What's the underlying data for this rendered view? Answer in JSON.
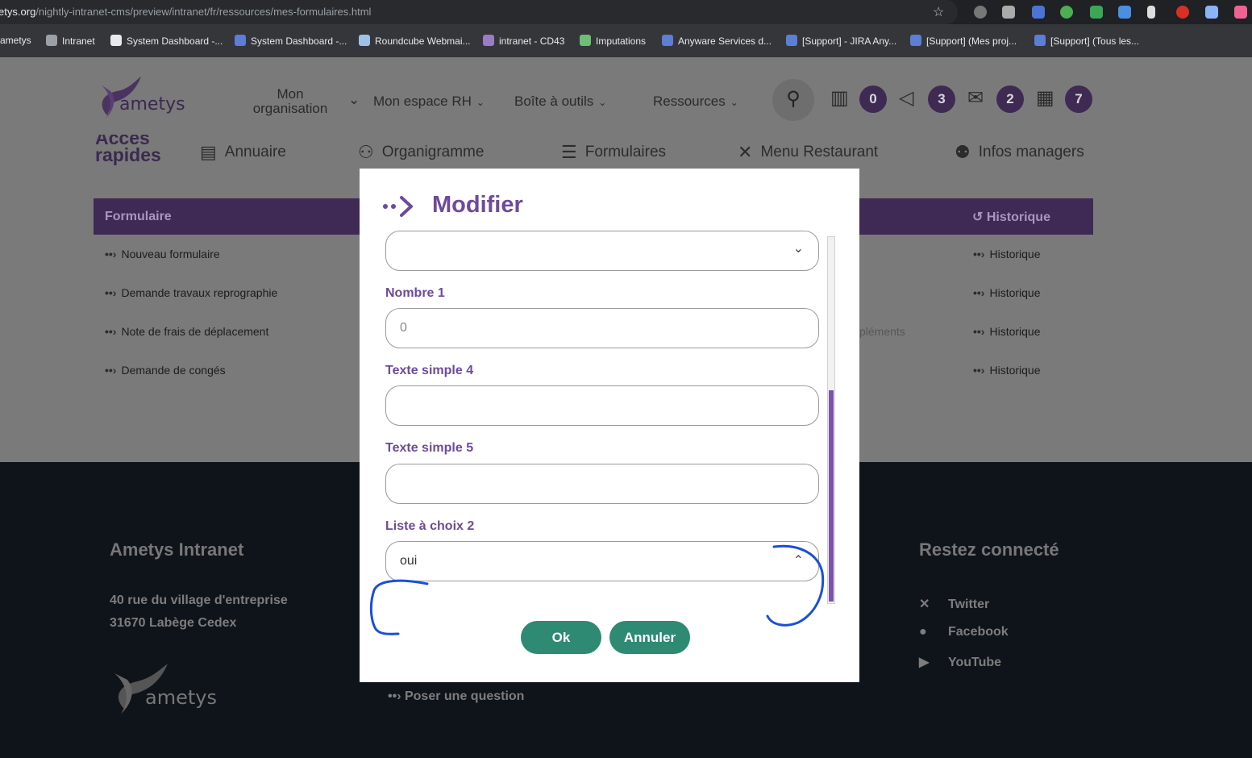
{
  "browser": {
    "url_domain": "ametys.org",
    "url_path": "/nightly-intranet-cms/preview/intranet/fr/ressources/mes-formulaires.html",
    "bookmarks": [
      "ametys",
      "Intranet",
      "System Dashboard -...",
      "System Dashboard -...",
      "Roundcube Webmai...",
      "intranet - CD43",
      "Imputations",
      "Anyware Services d...",
      "[Support] - JIRA Any...",
      "[Support] (Mes proj...",
      "[Support] (Tous les..."
    ]
  },
  "header": {
    "logo_text": "ametys",
    "nav": {
      "mon_organisation_line1": "Mon",
      "mon_organisation_line2": "organisation",
      "mon_espace_rh": "Mon espace RH",
      "boite_a_outils": "Boîte à outils",
      "ressources": "Ressources"
    },
    "badges": {
      "news": "0",
      "announcements": "3",
      "mail": "2",
      "calendar": "7"
    }
  },
  "quick_access": {
    "title_line1": "Accès",
    "title_line2": "rapides",
    "items": [
      "Annuaire",
      "Organigramme",
      "Formulaires",
      "Menu Restaurant",
      "Infos managers"
    ]
  },
  "forms_table": {
    "header": "Formulaire",
    "history_header": "Historique",
    "rows": [
      "Nouveau formulaire",
      "Demande travaux reprographie",
      "Note de frais de déplacement",
      "Demande de congés"
    ],
    "history_link": "Historique",
    "partial_text": "pléments"
  },
  "footer": {
    "title": "Ametys Intranet",
    "address_line1": "40 rue du village d'entreprise",
    "address_line2": "31670 Labège Cedex",
    "logo_text": "ametys",
    "question_link": "Poser une question",
    "social_title": "Restez connecté",
    "social": [
      "Twitter",
      "Facebook",
      "YouTube"
    ]
  },
  "modal": {
    "title": "Modifier",
    "fields": {
      "top_select_value": "",
      "nombre1_label": "Nombre 1",
      "nombre1_placeholder": "0",
      "texte4_label": "Texte simple 4",
      "texte5_label": "Texte simple 5",
      "liste2_label": "Liste à choix 2",
      "liste2_value": "oui"
    },
    "ok_label": "Ok",
    "cancel_label": "Annuler"
  },
  "colors": {
    "accent": "#6e4a9a",
    "button": "#2e8a72",
    "header_dark": "#3e2a55",
    "annotation": "#1a4fd8"
  }
}
